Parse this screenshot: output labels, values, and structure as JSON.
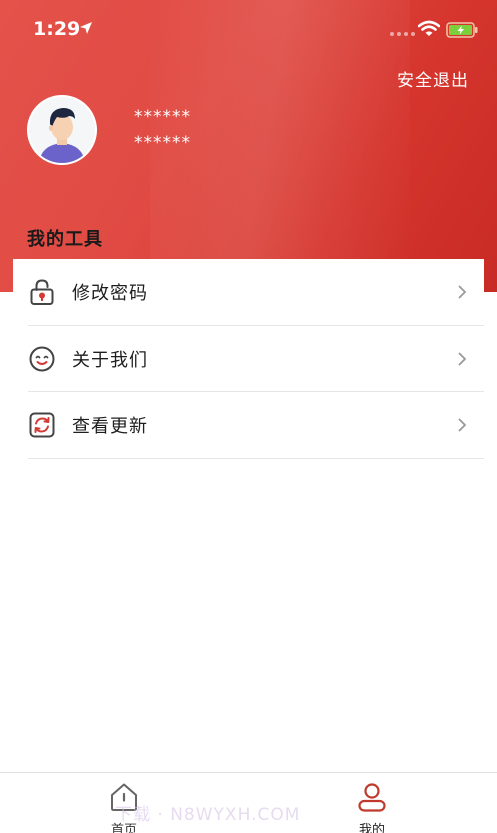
{
  "status_bar": {
    "time": "1:29"
  },
  "header": {
    "logout_label": "安全退出",
    "user_name": "******",
    "user_phone": "******"
  },
  "tools": {
    "title": "我的工具",
    "items": [
      {
        "label": "修改密码",
        "icon": "lock-icon"
      },
      {
        "label": "关于我们",
        "icon": "smile-icon"
      },
      {
        "label": "查看更新",
        "icon": "refresh-icon"
      }
    ]
  },
  "tabbar": {
    "tabs": [
      {
        "label": "首页",
        "icon": "home-icon",
        "active": false
      },
      {
        "label": "我的",
        "icon": "user-icon",
        "active": true
      }
    ]
  },
  "watermark": "下载 · N8WYXH.COM",
  "colors": {
    "header_red": "#e04a43",
    "accent_red": "#c0392b",
    "text_dark": "#1e1e1e",
    "divider": "#e6e6e6"
  }
}
